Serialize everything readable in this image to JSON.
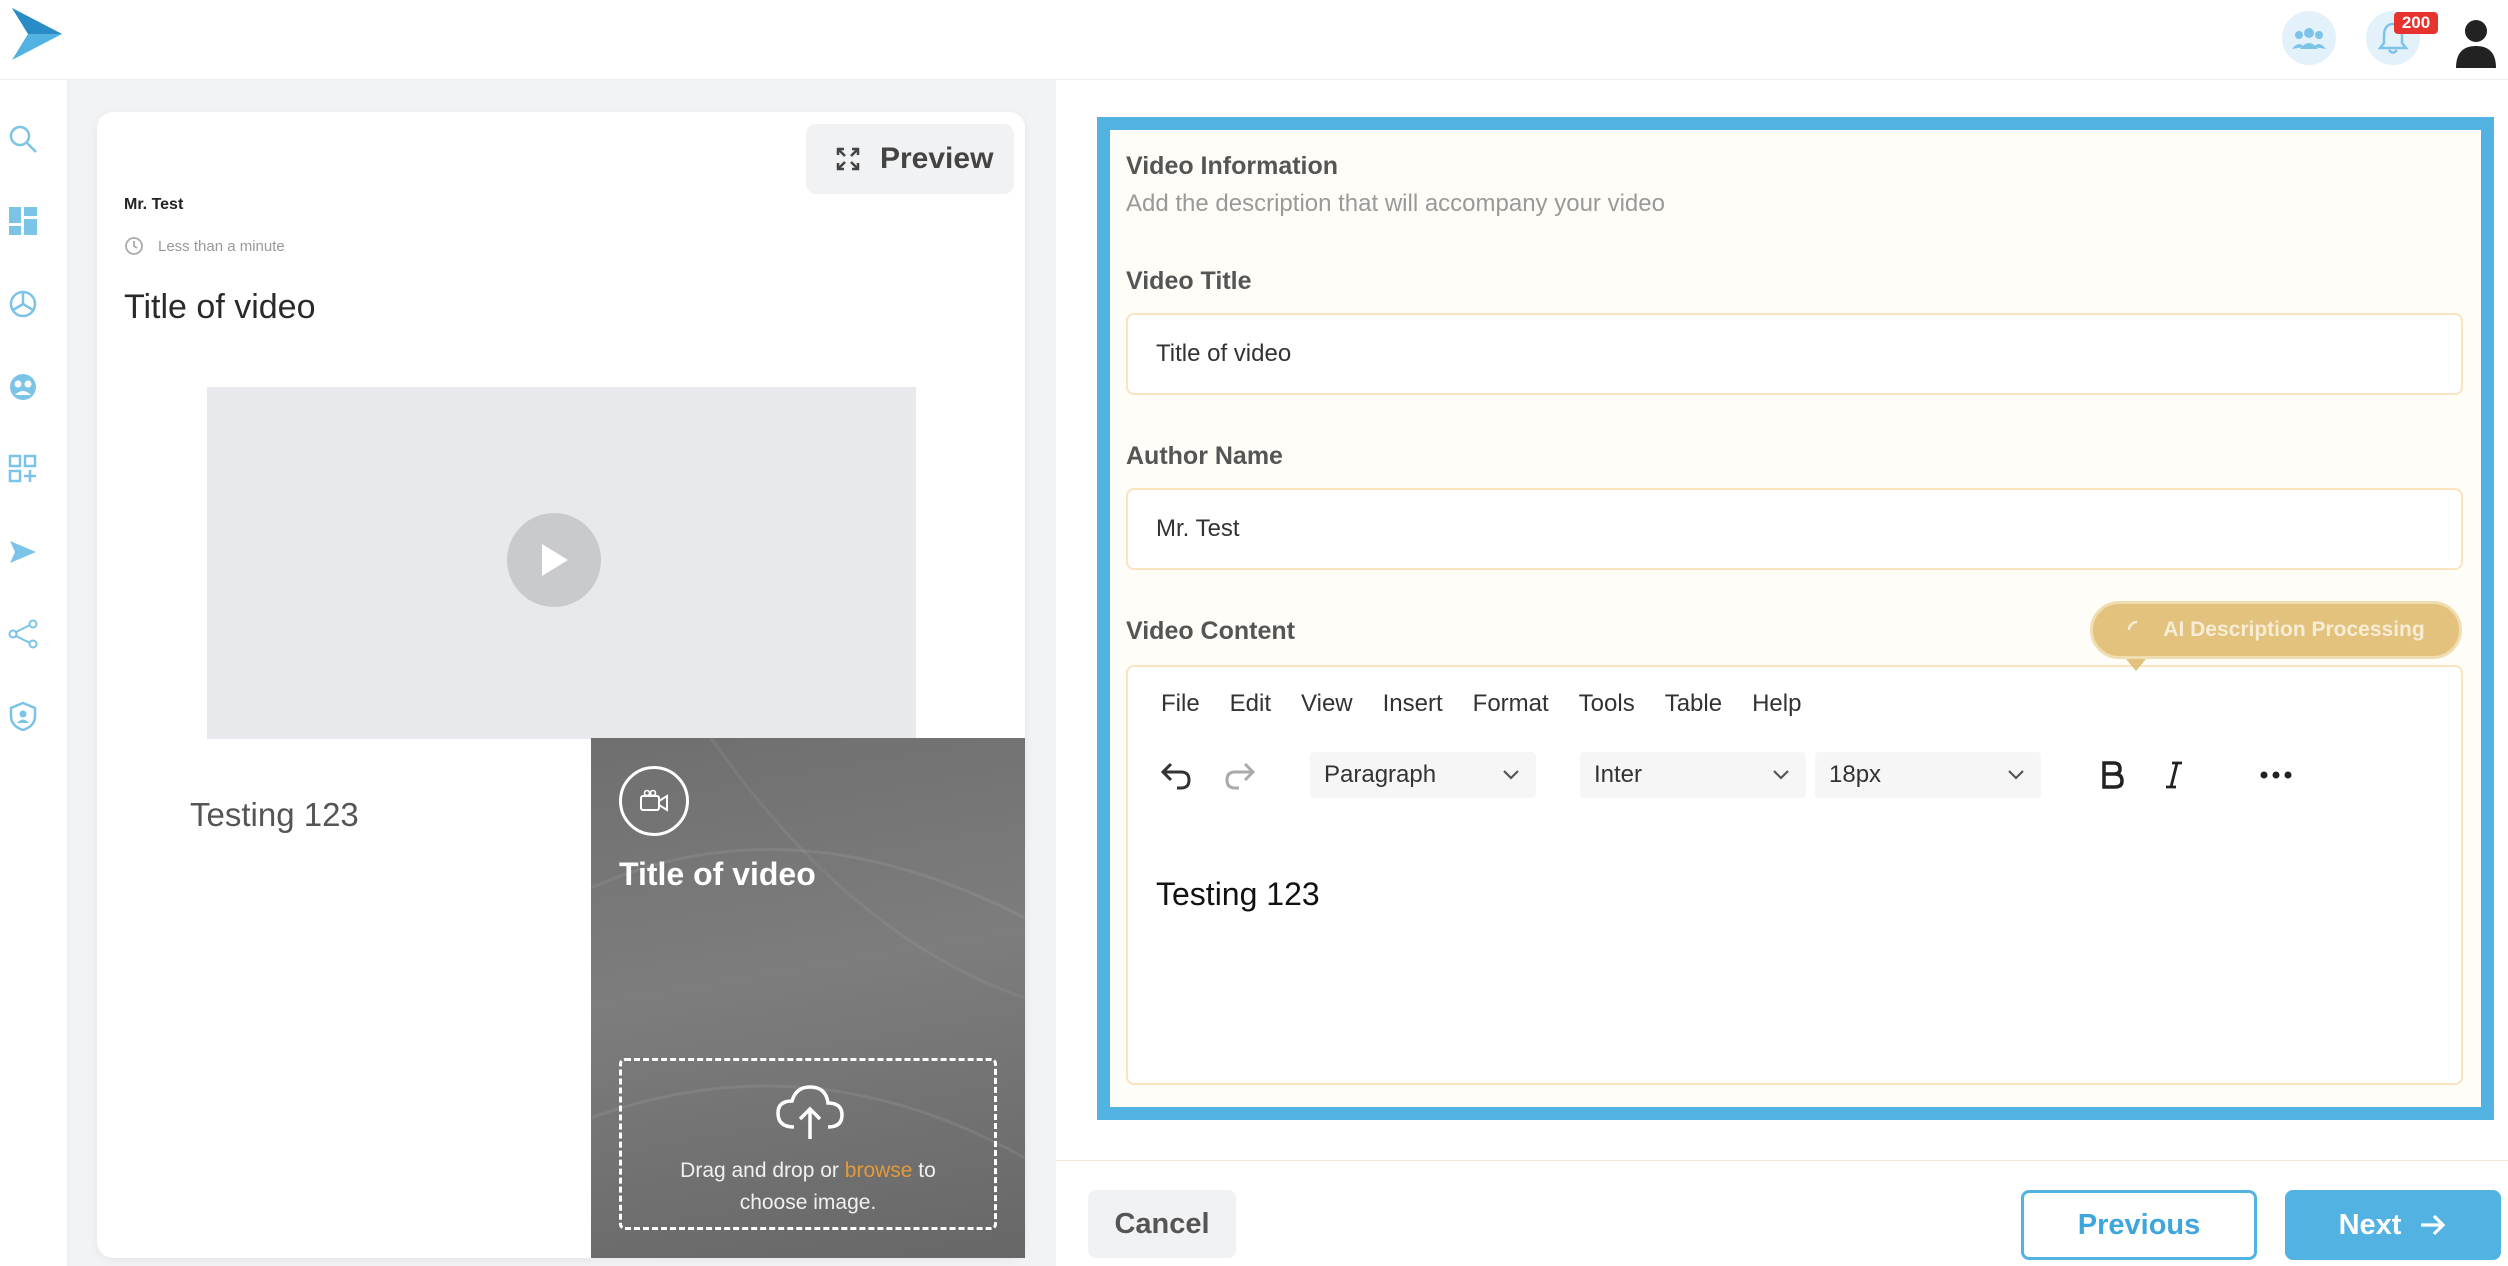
{
  "topbar": {
    "notification_count": "200",
    "brand_color": "#52b3e3"
  },
  "sidebar": {
    "items": [
      {
        "icon": "search-icon"
      },
      {
        "icon": "dashboard-icon"
      },
      {
        "icon": "analytics-icon"
      },
      {
        "icon": "audience-icon"
      },
      {
        "icon": "add-widget-icon"
      },
      {
        "icon": "send-icon"
      },
      {
        "icon": "share-icon"
      },
      {
        "icon": "shield-icon"
      }
    ]
  },
  "preview": {
    "button_label": "Preview",
    "author": "Mr. Test",
    "read_time": "Less than a minute",
    "title": "Title of video",
    "body": "Testing 123",
    "thumbnail": {
      "title": "Title of video",
      "drop_text_before": "Drag and drop or ",
      "browse_link": "browse",
      "drop_text_after": " to",
      "drop_text_line2": "choose image."
    }
  },
  "form": {
    "section_title": "Video Information",
    "section_subtitle": "Add the description that will accompany your video",
    "video_title_label": "Video Title",
    "video_title_value": "Title of video",
    "author_label": "Author Name",
    "author_value": "Mr. Test",
    "content_label": "Video Content",
    "ai_button_label": "AI Description Processing",
    "editor": {
      "menu": [
        "File",
        "Edit",
        "View",
        "Insert",
        "Format",
        "Tools",
        "Table",
        "Help"
      ],
      "block_format": "Paragraph",
      "font_family": "Inter",
      "font_size": "18px",
      "content": "Testing 123"
    }
  },
  "footer": {
    "cancel_label": "Cancel",
    "previous_label": "Previous",
    "next_label": "Next"
  }
}
